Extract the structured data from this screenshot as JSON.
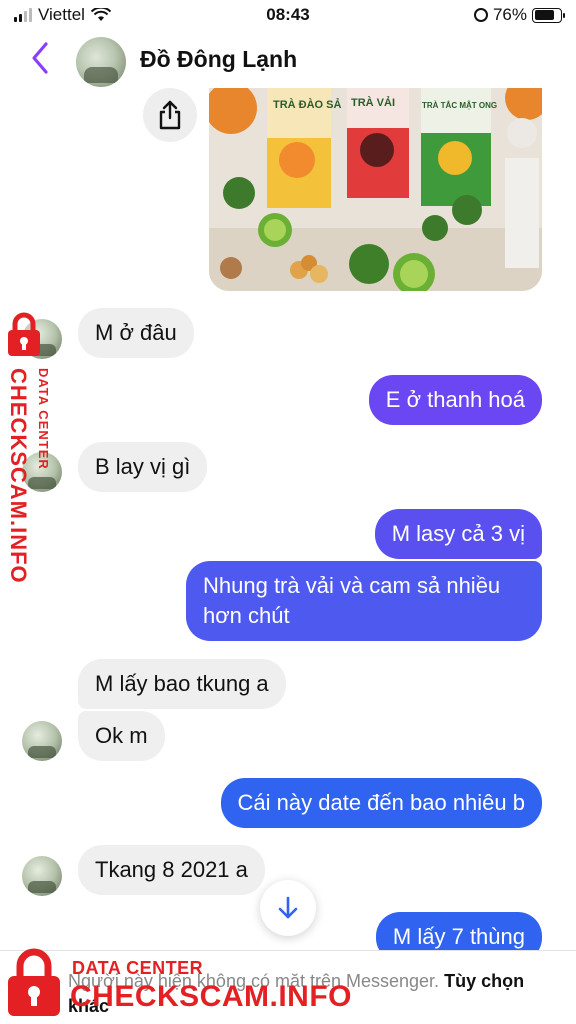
{
  "status_bar": {
    "carrier": "Viettel",
    "time": "08:43",
    "battery": "76%",
    "battery_level": 0.76
  },
  "header": {
    "contact_name": "Đồ Đông Lạnh",
    "back_icon": "chevron-left-icon",
    "accent_color": "#8a3ffc"
  },
  "photo": {
    "labels": [
      "TRÀ ĐÀO SẢ",
      "TRÀ VẢI",
      "TRÀ TẮC MẬT ONG"
    ]
  },
  "messages": [
    {
      "side": "in",
      "text": "M ở đâu"
    },
    {
      "side": "out",
      "text": "E ở thanh hoá"
    },
    {
      "side": "in",
      "text": "B lay vị gì"
    },
    {
      "side": "out",
      "text": "M lasy cả 3 vị"
    },
    {
      "side": "out",
      "text": "Nhung trà vải và cam sả nhiều hơn chút"
    },
    {
      "side": "in",
      "text": "M lấy bao tkung a"
    },
    {
      "side": "in",
      "text": "Ok m"
    },
    {
      "side": "out",
      "text": "Cái này date đến bao nhiêu b"
    },
    {
      "side": "in",
      "text": "Tkang 8 2021 a"
    },
    {
      "side": "out",
      "text": "M lấy 7 thùng"
    }
  ],
  "bubble_colors": {
    "in": "#efefef",
    "out_purple": "#6a47f2",
    "out_blue": "#2f63f0"
  },
  "footer": {
    "notice": "Người này hiện không có mặt trên Messenger.",
    "options_label": "Tùy chọn khác"
  },
  "watermark": {
    "small": "DATA CENTER",
    "big": "CHECKSCAM.INFO",
    "color": "#e32124"
  }
}
